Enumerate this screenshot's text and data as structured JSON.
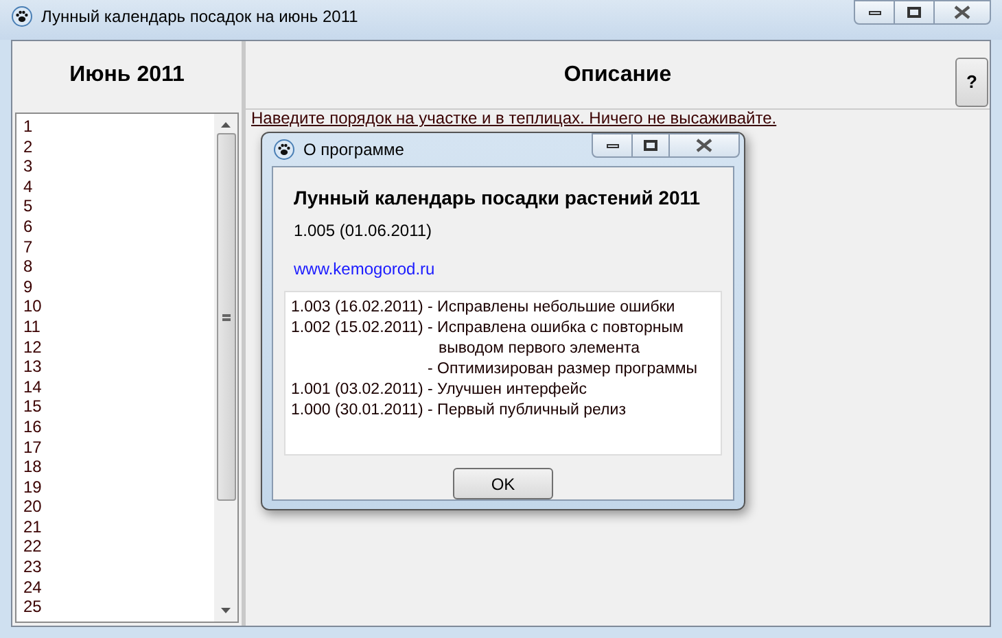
{
  "window": {
    "title": "Лунный календарь посадок на июнь 2011"
  },
  "left_panel": {
    "header": "Июнь 2011",
    "days": [
      "1",
      "2",
      "3",
      "4",
      "5",
      "6",
      "7",
      "8",
      "9",
      "10",
      "11",
      "12",
      "13",
      "14",
      "15",
      "16",
      "17",
      "18",
      "19",
      "20",
      "21",
      "22",
      "23",
      "24",
      "25"
    ]
  },
  "right_panel": {
    "header": "Описание",
    "help_button": "?",
    "description": "Наведите порядок на участке и в теплицах. Ничего не высаживайте."
  },
  "dialog": {
    "title": "О программе",
    "heading": "Лунный календарь посадки растений 2011",
    "version": "1.005 (01.06.2011)",
    "link": "www.kemogorod.ru",
    "changelog": [
      {
        "version": "1.003 (16.02.2011)",
        "changes": [
          "- Исправлены небольшие ошибки"
        ]
      },
      {
        "version": "1.002 (15.02.2011)",
        "changes": [
          "- Исправлена ошибка с повторным выводом первого элемента",
          "- Оптимизирован размер программы"
        ]
      },
      {
        "version": "1.001 (03.02.2011)",
        "changes": [
          "- Улучшен интерфейс"
        ]
      },
      {
        "version": "1.000 (30.01.2011)",
        "changes": [
          "- Первый публичный релиз"
        ]
      }
    ],
    "ok_button": "OK"
  }
}
